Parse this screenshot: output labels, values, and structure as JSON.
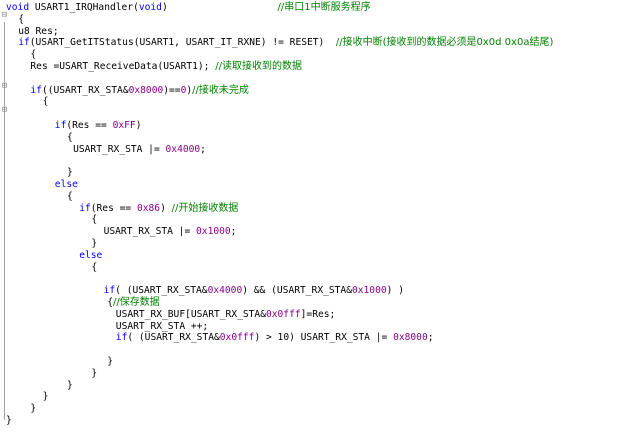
{
  "editor": {
    "colors": {
      "keyword": "#0000ff",
      "number": "#8b008b",
      "comment": "#008000",
      "text": "#000000",
      "background": "#ffffff"
    },
    "lines": [
      {
        "indent": 0,
        "segments": [
          {
            "t": "kw",
            "v": "void"
          },
          {
            "t": "plain",
            "v": " USART1_IRQHandler("
          },
          {
            "t": "kw",
            "v": "void"
          },
          {
            "t": "plain",
            "v": ")                   "
          },
          {
            "t": "cmt",
            "v": "//串口1中断服务程序"
          }
        ]
      },
      {
        "indent": 1,
        "segments": [
          {
            "t": "plain",
            "v": "{"
          }
        ]
      },
      {
        "indent": 1,
        "segments": [
          {
            "t": "plain",
            "v": "u8 Res;"
          }
        ]
      },
      {
        "indent": 1,
        "segments": [
          {
            "t": "kw",
            "v": "if"
          },
          {
            "t": "plain",
            "v": "(USART_GetITStatus(USART1, USART_IT_RXNE) != RESET)  "
          },
          {
            "t": "cmt",
            "v": "//接收中断(接收到的数据必须是0x0d 0x0a结尾)"
          }
        ]
      },
      {
        "indent": 2,
        "segments": [
          {
            "t": "plain",
            "v": "{"
          }
        ]
      },
      {
        "indent": 2,
        "segments": [
          {
            "t": "plain",
            "v": "Res =USART_ReceiveData(USART1); "
          },
          {
            "t": "cmt",
            "v": "//读取接收到的数据"
          }
        ]
      },
      {
        "indent": 0,
        "segments": []
      },
      {
        "indent": 2,
        "segments": [
          {
            "t": "kw",
            "v": "if"
          },
          {
            "t": "plain",
            "v": "((USART_RX_STA&"
          },
          {
            "t": "num",
            "v": "0x8000"
          },
          {
            "t": "plain",
            "v": ")=="
          },
          {
            "t": "num",
            "v": "0"
          },
          {
            "t": "plain",
            "v": ")"
          },
          {
            "t": "cmt",
            "v": "//接收未完成"
          }
        ]
      },
      {
        "indent": 3,
        "segments": [
          {
            "t": "plain",
            "v": "{"
          }
        ]
      },
      {
        "indent": 0,
        "segments": []
      },
      {
        "indent": 4,
        "segments": [
          {
            "t": "kw",
            "v": "if"
          },
          {
            "t": "plain",
            "v": "(Res == "
          },
          {
            "t": "num",
            "v": "0xFF"
          },
          {
            "t": "plain",
            "v": ")"
          }
        ]
      },
      {
        "indent": 5,
        "segments": [
          {
            "t": "plain",
            "v": "{"
          }
        ]
      },
      {
        "indent": 5.5,
        "segments": [
          {
            "t": "plain",
            "v": "USART_RX_STA |= "
          },
          {
            "t": "num",
            "v": "0x4000"
          },
          {
            "t": "plain",
            "v": ";"
          }
        ]
      },
      {
        "indent": 0,
        "segments": []
      },
      {
        "indent": 5,
        "segments": [
          {
            "t": "plain",
            "v": "}"
          }
        ]
      },
      {
        "indent": 4,
        "segments": [
          {
            "t": "kw",
            "v": "else"
          }
        ]
      },
      {
        "indent": 5,
        "segments": [
          {
            "t": "plain",
            "v": "{"
          }
        ]
      },
      {
        "indent": 6,
        "segments": [
          {
            "t": "kw",
            "v": "if"
          },
          {
            "t": "plain",
            "v": "(Res == "
          },
          {
            "t": "num",
            "v": "0x86"
          },
          {
            "t": "plain",
            "v": ") "
          },
          {
            "t": "cmt",
            "v": "//开始接收数据"
          }
        ]
      },
      {
        "indent": 7,
        "segments": [
          {
            "t": "plain",
            "v": "{"
          }
        ]
      },
      {
        "indent": 8,
        "segments": [
          {
            "t": "plain",
            "v": "USART_RX_STA |= "
          },
          {
            "t": "num",
            "v": "0x1000"
          },
          {
            "t": "plain",
            "v": ";"
          }
        ]
      },
      {
        "indent": 7,
        "segments": [
          {
            "t": "plain",
            "v": "}"
          }
        ]
      },
      {
        "indent": 6,
        "segments": [
          {
            "t": "kw",
            "v": "else"
          }
        ]
      },
      {
        "indent": 7,
        "segments": [
          {
            "t": "plain",
            "v": "{"
          }
        ]
      },
      {
        "indent": 0,
        "segments": []
      },
      {
        "indent": 8,
        "segments": [
          {
            "t": "kw",
            "v": "if"
          },
          {
            "t": "plain",
            "v": "( (USART_RX_STA&"
          },
          {
            "t": "num",
            "v": "0x4000"
          },
          {
            "t": "plain",
            "v": ") && (USART_RX_STA&"
          },
          {
            "t": "num",
            "v": "0x1000"
          },
          {
            "t": "plain",
            "v": ") )"
          }
        ]
      },
      {
        "indent": 8.3,
        "segments": [
          {
            "t": "plain",
            "v": "{"
          },
          {
            "t": "cmt",
            "v": "//保存数据"
          }
        ]
      },
      {
        "indent": 9,
        "segments": [
          {
            "t": "plain",
            "v": "USART_RX_BUF[USART_RX_STA&"
          },
          {
            "t": "num",
            "v": "0x0fff"
          },
          {
            "t": "plain",
            "v": "]=Res;"
          }
        ]
      },
      {
        "indent": 9,
        "segments": [
          {
            "t": "plain",
            "v": "USART_RX_STA ++;"
          }
        ]
      },
      {
        "indent": 9,
        "segments": [
          {
            "t": "kw",
            "v": "if"
          },
          {
            "t": "plain",
            "v": "( (USART_RX_STA&"
          },
          {
            "t": "num",
            "v": "0x0fff"
          },
          {
            "t": "plain",
            "v": ") > 10) USART_RX_STA |= "
          },
          {
            "t": "num",
            "v": "0x8000"
          },
          {
            "t": "plain",
            "v": ";"
          }
        ]
      },
      {
        "indent": 0,
        "segments": []
      },
      {
        "indent": 8.3,
        "segments": [
          {
            "t": "plain",
            "v": "}"
          }
        ]
      },
      {
        "indent": 7,
        "segments": [
          {
            "t": "plain",
            "v": "}"
          }
        ]
      },
      {
        "indent": 5,
        "segments": [
          {
            "t": "plain",
            "v": "}"
          }
        ]
      },
      {
        "indent": 3,
        "segments": [
          {
            "t": "plain",
            "v": "}"
          }
        ]
      },
      {
        "indent": 2,
        "segments": [
          {
            "t": "plain",
            "v": "}"
          }
        ]
      },
      {
        "indent": 0,
        "segments": [
          {
            "t": "plain",
            "v": "}"
          }
        ]
      }
    ]
  }
}
